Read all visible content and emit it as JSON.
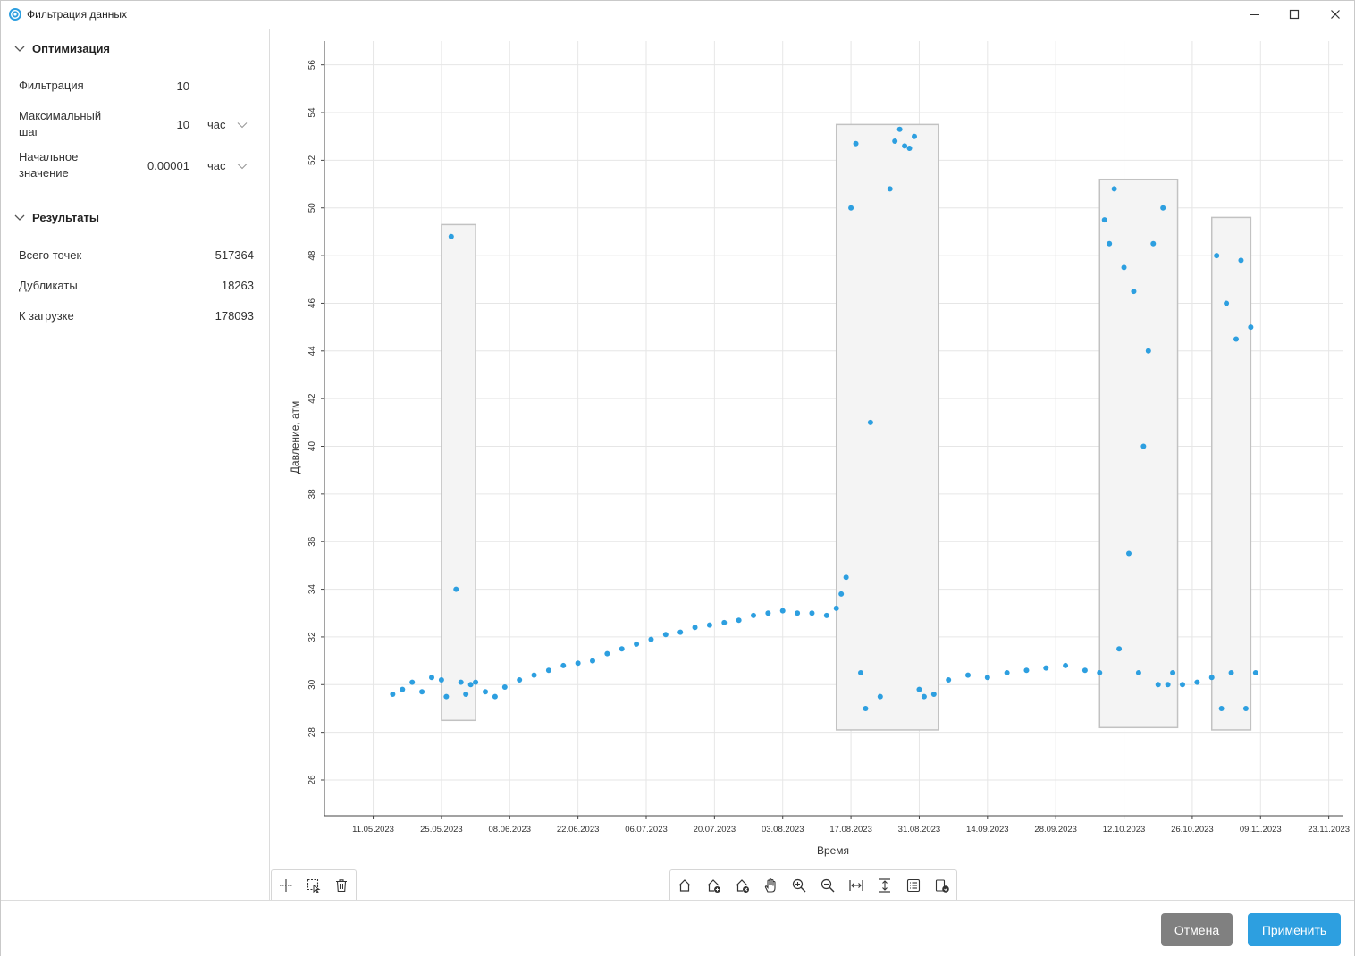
{
  "window": {
    "title": "Фильтрация данных",
    "minimize_icon": "minimize-icon",
    "maximize_icon": "maximize-icon",
    "close_icon": "close-icon"
  },
  "optimization": {
    "header": "Оптимизация",
    "filtration_label": "Фильтрация",
    "filtration_value": "10",
    "max_step_label_1": "Максимальный",
    "max_step_label_2": "шаг",
    "max_step_value": "10",
    "max_step_unit": "час",
    "initial_label_1": "Начальное",
    "initial_label_2": "значение",
    "initial_value": "0.00001",
    "initial_unit": "час"
  },
  "results": {
    "header": "Результаты",
    "total_label": "Всего точек",
    "total_value": "517364",
    "duplicates_label": "Дубликаты",
    "duplicates_value": "18263",
    "to_load_label": "К загрузке",
    "to_load_value": "178093"
  },
  "buttons": {
    "cancel": "Отмена",
    "apply": "Применить",
    "cancel_color": "#808080",
    "apply_color": "#2d9fe0"
  },
  "toolbar_left": [
    "crosshair-icon",
    "select-region-icon",
    "trash-icon"
  ],
  "toolbar_main": [
    "home-icon",
    "add-point-icon",
    "remove-point-icon",
    "pan-hand-icon",
    "zoom-in-icon",
    "zoom-out-icon",
    "fit-width-icon",
    "fit-height-icon",
    "list-icon",
    "export-icon"
  ],
  "chart_data": {
    "type": "scatter",
    "xlabel": "Время",
    "ylabel": "Давление, атм",
    "x_ticks": [
      "11.05.2023",
      "25.05.2023",
      "08.06.2023",
      "22.06.2023",
      "06.07.2023",
      "20.07.2023",
      "03.08.2023",
      "17.08.2023",
      "31.08.2023",
      "14.09.2023",
      "28.09.2023",
      "12.10.2023",
      "26.10.2023",
      "09.11.2023",
      "23.11.2023"
    ],
    "x_range": [
      "2023-05-01",
      "2023-11-26"
    ],
    "y_ticks": [
      26,
      28,
      30,
      32,
      34,
      36,
      38,
      40,
      42,
      44,
      46,
      48,
      50,
      52,
      54,
      56
    ],
    "ylim": [
      24.5,
      57
    ],
    "grid": true,
    "point_color": "#2d9fe0",
    "highlight_regions": [
      {
        "x_start": "2023-05-25",
        "x_end": "2023-06-01",
        "y_min": 28.5,
        "y_max": 49.3
      },
      {
        "x_start": "2023-08-14",
        "x_end": "2023-09-04",
        "y_min": 28.1,
        "y_max": 53.5
      },
      {
        "x_start": "2023-10-07",
        "x_end": "2023-10-23",
        "y_min": 28.2,
        "y_max": 51.2
      },
      {
        "x_start": "2023-10-30",
        "x_end": "2023-11-07",
        "y_min": 28.1,
        "y_max": 49.6
      }
    ],
    "series": [
      {
        "x": [
          "2023-05-15",
          "2023-05-17",
          "2023-05-19",
          "2023-05-21",
          "2023-05-23",
          "2023-05-25",
          "2023-05-26",
          "2023-05-27",
          "2023-05-28",
          "2023-05-29",
          "2023-05-30",
          "2023-05-31",
          "2023-06-01",
          "2023-06-03",
          "2023-06-05",
          "2023-06-07",
          "2023-06-10",
          "2023-06-13",
          "2023-06-16",
          "2023-06-19",
          "2023-06-22",
          "2023-06-25",
          "2023-06-28",
          "2023-07-01",
          "2023-07-04",
          "2023-07-07",
          "2023-07-10",
          "2023-07-13",
          "2023-07-16",
          "2023-07-19",
          "2023-07-22",
          "2023-07-25",
          "2023-07-28",
          "2023-07-31",
          "2023-08-03",
          "2023-08-06",
          "2023-08-09",
          "2023-08-12",
          "2023-08-14",
          "2023-08-15",
          "2023-08-16",
          "2023-08-17",
          "2023-08-18",
          "2023-08-19",
          "2023-08-20",
          "2023-08-21",
          "2023-08-23",
          "2023-08-25",
          "2023-08-26",
          "2023-08-27",
          "2023-08-28",
          "2023-08-29",
          "2023-08-30",
          "2023-08-31",
          "2023-09-01",
          "2023-09-03",
          "2023-09-06",
          "2023-09-10",
          "2023-09-14",
          "2023-09-18",
          "2023-09-22",
          "2023-09-26",
          "2023-09-30",
          "2023-10-04",
          "2023-10-07",
          "2023-10-08",
          "2023-10-09",
          "2023-10-10",
          "2023-10-11",
          "2023-10-12",
          "2023-10-13",
          "2023-10-14",
          "2023-10-15",
          "2023-10-16",
          "2023-10-17",
          "2023-10-18",
          "2023-10-19",
          "2023-10-20",
          "2023-10-21",
          "2023-10-22",
          "2023-10-24",
          "2023-10-27",
          "2023-10-30",
          "2023-10-31",
          "2023-11-01",
          "2023-11-02",
          "2023-11-03",
          "2023-11-04",
          "2023-11-05",
          "2023-11-06",
          "2023-11-07",
          "2023-11-08"
        ],
        "y": [
          29.6,
          29.8,
          30.1,
          29.7,
          30.3,
          30.2,
          29.5,
          48.8,
          34.0,
          30.1,
          29.6,
          30.0,
          30.1,
          29.7,
          29.5,
          29.9,
          30.2,
          30.4,
          30.6,
          30.8,
          30.9,
          31.0,
          31.3,
          31.5,
          31.7,
          31.9,
          32.1,
          32.2,
          32.4,
          32.5,
          32.6,
          32.7,
          32.9,
          33.0,
          33.1,
          33.0,
          33.0,
          32.9,
          33.2,
          33.8,
          34.5,
          50.0,
          52.7,
          30.5,
          29.0,
          41.0,
          29.5,
          50.8,
          52.8,
          53.3,
          52.6,
          52.5,
          53.0,
          29.8,
          29.5,
          29.6,
          30.2,
          30.4,
          30.3,
          30.5,
          30.6,
          30.7,
          30.8,
          30.6,
          30.5,
          49.5,
          48.5,
          50.8,
          31.5,
          47.5,
          35.5,
          46.5,
          30.5,
          40.0,
          44.0,
          48.5,
          30.0,
          50.0,
          30.0,
          30.5,
          30.0,
          30.1,
          30.3,
          48.0,
          29.0,
          46.0,
          30.5,
          44.5,
          47.8,
          29.0,
          45.0,
          30.5
        ]
      }
    ]
  }
}
